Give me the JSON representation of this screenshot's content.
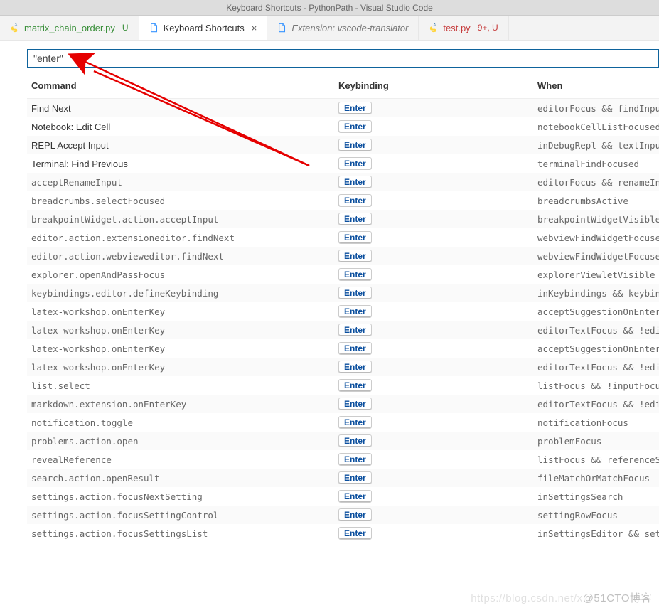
{
  "window": {
    "title": "Keyboard Shortcuts - PythonPath - Visual Studio Code"
  },
  "tabs": [
    {
      "icon": "python",
      "label": "matrix_chain_order.py",
      "status": "U",
      "colorClass": "tab-green",
      "active": false,
      "closable": false,
      "italic": false
    },
    {
      "icon": "doc",
      "label": "Keyboard Shortcuts",
      "status": "",
      "colorClass": "tab-regular",
      "active": true,
      "closable": true,
      "italic": false
    },
    {
      "icon": "doc",
      "label": "Extension: vscode-translator",
      "status": "",
      "colorClass": "tab-italic",
      "active": false,
      "closable": false,
      "italic": true
    },
    {
      "icon": "python",
      "label": "test.py",
      "status": "9+, U",
      "colorClass": "tab-red",
      "active": false,
      "closable": false,
      "italic": false
    }
  ],
  "search": {
    "value": "\"enter\""
  },
  "columns": {
    "command": "Command",
    "keybinding": "Keybinding",
    "when": "When"
  },
  "rows": [
    {
      "command": "Find Next",
      "isId": false,
      "key": "Enter",
      "when": "editorFocus && findInputFocussed"
    },
    {
      "command": "Notebook: Edit Cell",
      "isId": false,
      "key": "Enter",
      "when": "notebookCellListFocused"
    },
    {
      "command": "REPL Accept Input",
      "isId": false,
      "key": "Enter",
      "when": "inDebugRepl && textInputFocus"
    },
    {
      "command": "Terminal: Find Previous",
      "isId": false,
      "key": "Enter",
      "when": "terminalFindFocused"
    },
    {
      "command": "acceptRenameInput",
      "isId": true,
      "key": "Enter",
      "when": "editorFocus && renameInputVisible"
    },
    {
      "command": "breadcrumbs.selectFocused",
      "isId": true,
      "key": "Enter",
      "when": "breadcrumbsActive"
    },
    {
      "command": "breakpointWidget.action.acceptInput",
      "isId": true,
      "key": "Enter",
      "when": "breakpointWidgetVisible"
    },
    {
      "command": "editor.action.extensioneditor.findNext",
      "isId": true,
      "key": "Enter",
      "when": "webviewFindWidgetFocused"
    },
    {
      "command": "editor.action.webvieweditor.findNext",
      "isId": true,
      "key": "Enter",
      "when": "webviewFindWidgetFocused"
    },
    {
      "command": "explorer.openAndPassFocus",
      "isId": true,
      "key": "Enter",
      "when": "explorerViewletVisible"
    },
    {
      "command": "keybindings.editor.defineKeybinding",
      "isId": true,
      "key": "Enter",
      "when": "inKeybindings && keybindingFocus"
    },
    {
      "command": "latex-workshop.onEnterKey",
      "isId": true,
      "key": "Enter",
      "when": "acceptSuggestionOnEnter"
    },
    {
      "command": "latex-workshop.onEnterKey",
      "isId": true,
      "key": "Enter",
      "when": "editorTextFocus && !editorReadonly"
    },
    {
      "command": "latex-workshop.onEnterKey",
      "isId": true,
      "key": "Enter",
      "when": "acceptSuggestionOnEnter"
    },
    {
      "command": "latex-workshop.onEnterKey",
      "isId": true,
      "key": "Enter",
      "when": "editorTextFocus && !editorReadonly"
    },
    {
      "command": "list.select",
      "isId": true,
      "key": "Enter",
      "when": "listFocus && !inputFocus"
    },
    {
      "command": "markdown.extension.onEnterKey",
      "isId": true,
      "key": "Enter",
      "when": "editorTextFocus && !editorReadonly"
    },
    {
      "command": "notification.toggle",
      "isId": true,
      "key": "Enter",
      "when": "notificationFocus"
    },
    {
      "command": "problems.action.open",
      "isId": true,
      "key": "Enter",
      "when": "problemFocus"
    },
    {
      "command": "revealReference",
      "isId": true,
      "key": "Enter",
      "when": "listFocus && referenceSearchVisible"
    },
    {
      "command": "search.action.openResult",
      "isId": true,
      "key": "Enter",
      "when": "fileMatchOrMatchFocus"
    },
    {
      "command": "settings.action.focusNextSetting",
      "isId": true,
      "key": "Enter",
      "when": "inSettingsSearch"
    },
    {
      "command": "settings.action.focusSettingControl",
      "isId": true,
      "key": "Enter",
      "when": "settingRowFocus"
    },
    {
      "command": "settings.action.focusSettingsList",
      "isId": true,
      "key": "Enter",
      "when": "inSettingsEditor && settingsTocRowFocus"
    }
  ],
  "watermark": {
    "left": "https://blog.csdn.net/x",
    "right": "@51CTO博客"
  }
}
